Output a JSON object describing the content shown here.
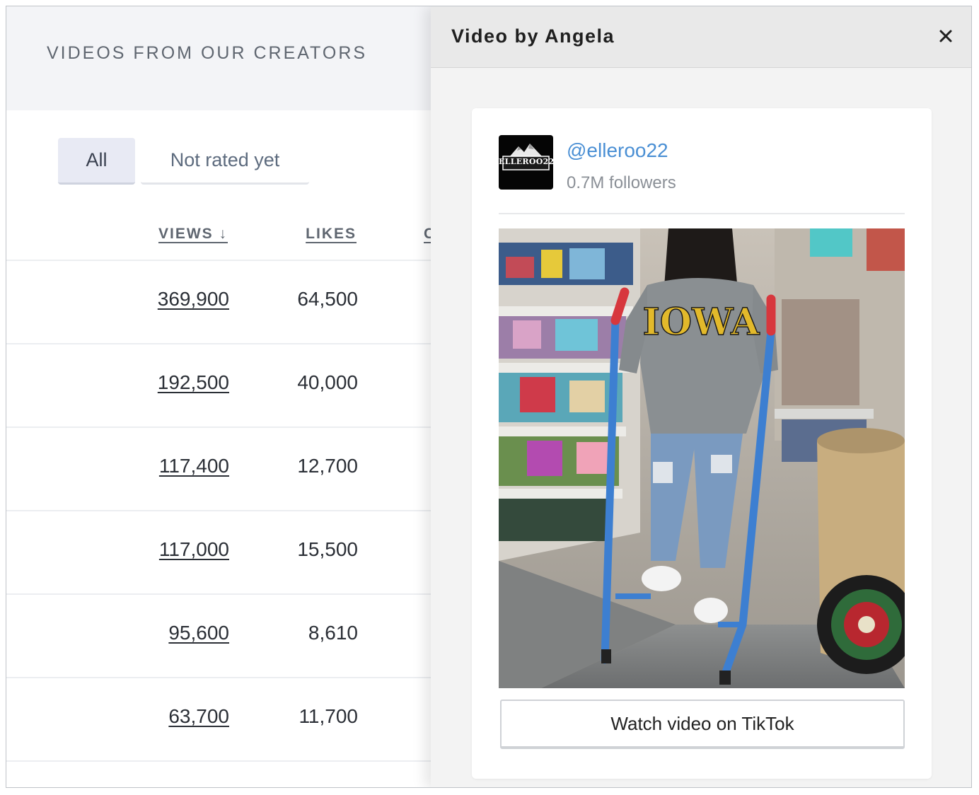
{
  "page": {
    "title": "VIDEOS FROM OUR CREATORS"
  },
  "tabs": [
    {
      "label": "All",
      "active": true
    },
    {
      "label": "Not rated yet",
      "active": false
    }
  ],
  "table": {
    "columns": {
      "views": "VIEWS ↓",
      "likes": "LIKES",
      "third": "C"
    },
    "rows": [
      {
        "views": "369,900",
        "likes": "64,500"
      },
      {
        "views": "192,500",
        "likes": "40,000"
      },
      {
        "views": "117,400",
        "likes": "12,700"
      },
      {
        "views": "117,000",
        "likes": "15,500"
      },
      {
        "views": "95,600",
        "likes": "8,610"
      },
      {
        "views": "63,700",
        "likes": "11,700"
      }
    ]
  },
  "panel": {
    "title": "Video by Angela",
    "close_icon": "close-icon",
    "creator": {
      "avatar_text": "ELLEROO22",
      "handle": "@elleroo22",
      "followers": "0.7M followers"
    },
    "thumbnail": {
      "shirt_text": "IOWA"
    },
    "watch_button": "Watch video on TikTok"
  },
  "colors": {
    "link_blue": "#4a8fd4",
    "tab_active_bg": "#e8eaf4",
    "header_bg": "#f3f4f7"
  }
}
